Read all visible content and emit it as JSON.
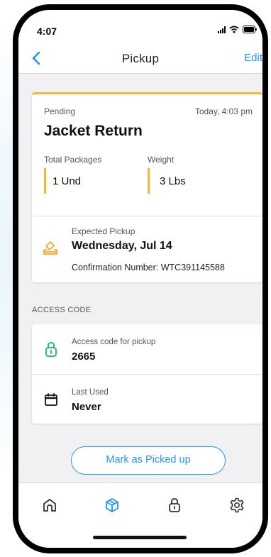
{
  "status_bar": {
    "time": "4:07"
  },
  "nav": {
    "title": "Pickup",
    "edit_label": "Edit"
  },
  "pickup": {
    "status": "Pending",
    "time": "Today, 4:03 pm",
    "title": "Jacket Return",
    "total_packages_label": "Total Packages",
    "total_packages_value": "1 Und",
    "weight_label": "Weight",
    "weight_value": "3 Lbs",
    "expected_label": "Expected Pickup",
    "expected_date": "Wednesday, Jul 14",
    "confirmation": "Confirmation Number: WTC391145588"
  },
  "access_section": {
    "header": "ACCESS CODE",
    "code_label": "Access code for pickup",
    "code_value": "2665",
    "last_used_label": "Last Used",
    "last_used_value": "Never"
  },
  "actions": {
    "mark_picked_up": "Mark as Picked up"
  },
  "tabs": [
    {
      "icon": "home-icon",
      "active": false
    },
    {
      "icon": "package-icon",
      "active": true
    },
    {
      "icon": "lock-icon",
      "active": false
    },
    {
      "icon": "gear-icon",
      "active": false
    }
  ],
  "colors": {
    "accent": "#2196f3",
    "pending": "#f5b43a",
    "access_green": "#16b37a"
  }
}
